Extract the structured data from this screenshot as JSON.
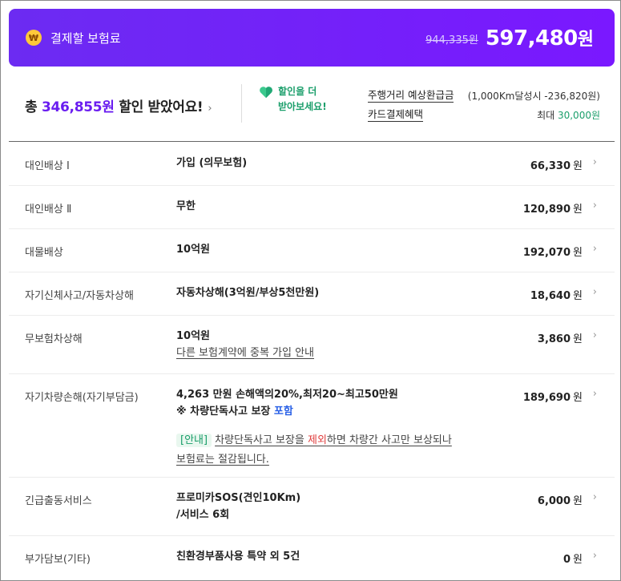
{
  "header": {
    "title": "결제할 보험료",
    "coin_icon": "won-coin-icon",
    "original_price": "944,335원",
    "final_price": "597,480",
    "final_unit": "원"
  },
  "summary": {
    "prefix": "총 ",
    "amount": "346,855원",
    "suffix": " 할인 받았어요!",
    "more_line1": "할인을 더",
    "more_line2": "받아보세요!",
    "benefits": [
      {
        "label": "주행거리 예상환급금",
        "value": "(1,000Km달성시 -236,820원)"
      },
      {
        "label": "카드결제혜택",
        "value_prefix": "최대 ",
        "value_highlight": "30,000원"
      }
    ]
  },
  "coverages": [
    {
      "name": "대인배상 Ⅰ",
      "detail": "가입 (의무보험)",
      "price": "66,330",
      "unit": "원"
    },
    {
      "name": "대인배상 Ⅱ",
      "detail": "무한",
      "price": "120,890",
      "unit": "원"
    },
    {
      "name": "대물배상",
      "detail": "10억원",
      "price": "192,070",
      "unit": "원"
    },
    {
      "name": "자기신체사고/자동차상해",
      "detail": "자동차상해(3억원/부상5천만원)",
      "price": "18,640",
      "unit": "원"
    },
    {
      "name": "무보험차상해",
      "detail": "10억원",
      "sub_link": "다른 보험계약에 중복 가입 안내",
      "price": "3,860",
      "unit": "원"
    },
    {
      "name": "자기차량손해(자기부담금)",
      "detail": "4,263 만원 손해액의20%,최저20~최고50만원",
      "detail2_prefix": "※ 차량단독사고 보장 ",
      "detail2_highlight": "포함",
      "notice_tag": "[안내]",
      "notice_1": "차량단독사고 보장을 ",
      "notice_red": "제외",
      "notice_2": "하면 차량간 사고만 보상되나",
      "notice_3": "보험료는 절감됩니다.",
      "price": "189,690",
      "unit": "원"
    },
    {
      "name": "긴급출동서비스",
      "detail": "프로미카SOS(견인10Km)",
      "detail2": "/서비스 6회",
      "price": "6,000",
      "unit": "원"
    },
    {
      "name": "부가담보(기타)",
      "detail": "친환경부품사용 특약 외 5건",
      "price": "0",
      "unit": "원"
    }
  ],
  "chevron": "›",
  "colors": {
    "accent": "#6c2bf2",
    "green": "#1a9e6a",
    "blue": "#2960e6",
    "red": "#e03c3c"
  }
}
